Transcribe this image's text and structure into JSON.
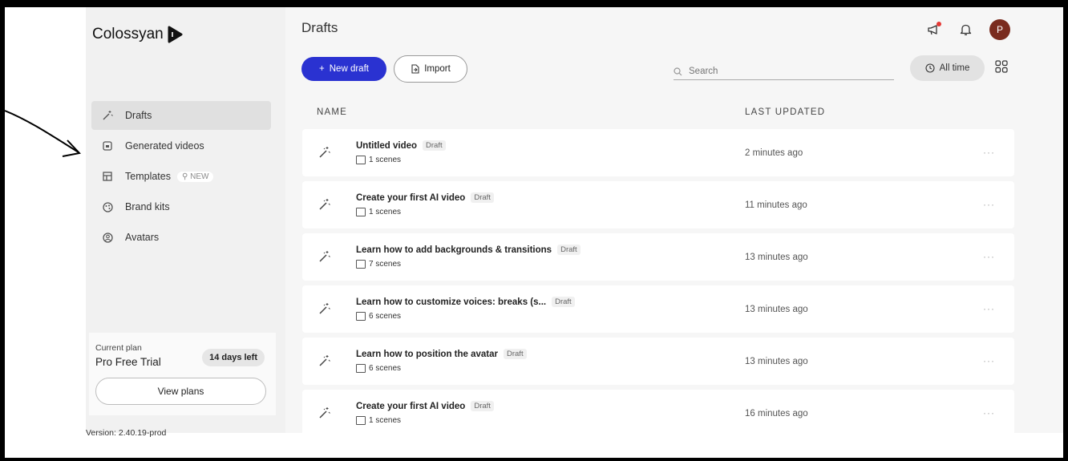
{
  "sidebar": {
    "logo_text": "Colossyan",
    "items": [
      {
        "label": "Drafts",
        "icon": "wand-icon",
        "active": true
      },
      {
        "label": "Generated videos",
        "icon": "video-box-icon",
        "active": false
      },
      {
        "label": "Templates",
        "icon": "template-icon",
        "active": false,
        "badge": "NEW"
      },
      {
        "label": "Brand kits",
        "icon": "palette-icon",
        "active": false
      },
      {
        "label": "Avatars",
        "icon": "avatar-circle-icon",
        "active": false
      }
    ],
    "plan": {
      "label": "Current plan",
      "name": "Pro Free Trial",
      "days_left": "14 days left",
      "button": "View plans"
    },
    "version": "Version: 2.40.19-prod"
  },
  "header": {
    "title": "Drafts",
    "avatar_initial": "P",
    "notification_dot_color": "#e53935"
  },
  "toolbar": {
    "new_draft": "New draft",
    "import": "Import",
    "search_placeholder": "Search",
    "time_filter": "All time"
  },
  "table": {
    "columns": [
      "NAME",
      "LAST UPDATED"
    ],
    "rows": [
      {
        "title": "Untitled video",
        "tag": "Draft",
        "scenes": "1 scenes",
        "updated": "2 minutes ago"
      },
      {
        "title": "Create your first AI video",
        "tag": "Draft",
        "scenes": "1 scenes",
        "updated": "11 minutes ago"
      },
      {
        "title": "Learn how to add backgrounds & transitions",
        "tag": "Draft",
        "scenes": "7 scenes",
        "updated": "13 minutes ago"
      },
      {
        "title": "Learn how to customize voices: breaks (s...",
        "tag": "Draft",
        "scenes": "6 scenes",
        "updated": "13 minutes ago"
      },
      {
        "title": "Learn how to position the avatar",
        "tag": "Draft",
        "scenes": "6 scenes",
        "updated": "13 minutes ago"
      },
      {
        "title": "Create your first AI video",
        "tag": "Draft",
        "scenes": "1 scenes",
        "updated": "16 minutes ago"
      }
    ]
  },
  "colors": {
    "primary": "#2a32d1",
    "avatar_bg": "#7a2b1e"
  }
}
